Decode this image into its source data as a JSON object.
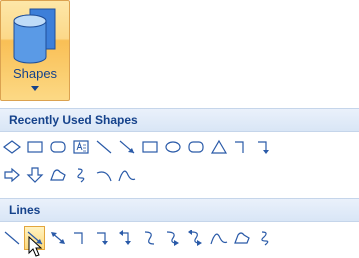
{
  "ribbon": {
    "shapes_button": {
      "label": "Shapes",
      "icon": "shapes-icon",
      "dropdown_icon": "chevron-down-icon"
    }
  },
  "gallery": {
    "recent_header": "Recently Used Shapes",
    "lines_header": "Lines",
    "recent_row1": [
      "diamond",
      "rectangle",
      "rounded-rectangle",
      "text-box",
      "line",
      "arrow",
      "rectangle",
      "oval",
      "rounded-rectangle",
      "triangle",
      "elbow-connector",
      "elbow-arrow-connector"
    ],
    "recent_row2": [
      "right-arrow",
      "down-arrow",
      "freeform",
      "scribble",
      "arc",
      "curve"
    ],
    "lines_row": [
      "line",
      "arrow",
      "double-arrow",
      "elbow-connector",
      "elbow-arrow-connector",
      "elbow-double-arrow-connector",
      "curved-connector",
      "curved-arrow-connector",
      "curved-double-arrow-connector",
      "curve",
      "freeform",
      "scribble"
    ],
    "hovered_shape": "arrow"
  }
}
